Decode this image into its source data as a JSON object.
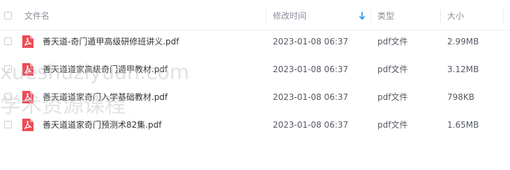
{
  "header": {
    "name_label": "文件名",
    "time_label": "修改时间",
    "type_label": "类型",
    "size_label": "大小",
    "sort_icon": "sort-down-arrow-icon"
  },
  "files": [
    {
      "name": "善天道-奇门遁甲高级研修班讲义.pdf",
      "modified": "2023-01-08 06:37",
      "type": "pdf文件",
      "size": "2.99MB"
    },
    {
      "name": "善天道道家高级奇门遁甲教材.pdf",
      "modified": "2023-01-08 06:37",
      "type": "pdf文件",
      "size": "3.12MB"
    },
    {
      "name": "善天道道家奇门入学基础教材.pdf",
      "modified": "2023-01-08 06:37",
      "type": "pdf文件",
      "size": "798KB"
    },
    {
      "name": "善天道道家奇门预测术82集.pdf",
      "modified": "2023-01-08 06:37",
      "type": "pdf文件",
      "size": "1.65MB"
    }
  ],
  "watermark": {
    "line1": "xueshuziyuan.com",
    "line2": "学术资源课程"
  },
  "colors": {
    "pdf_icon": "#ef4a54",
    "sort_arrow": "#2b8ff2",
    "header_text": "#8a8f99",
    "watermark": "#c8cbd0"
  }
}
